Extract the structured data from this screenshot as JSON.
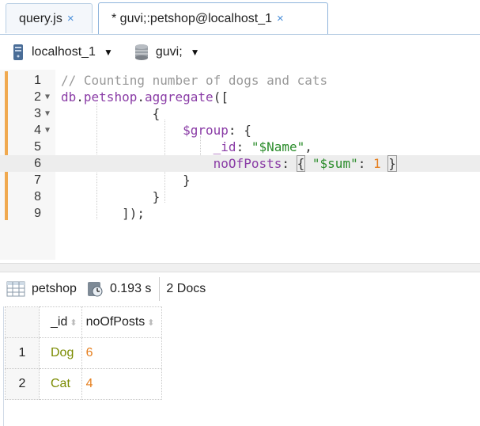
{
  "tabs": [
    {
      "label": "query.js",
      "close": "×"
    },
    {
      "label": "* guvi;:petshop@localhost_1",
      "close": "×"
    }
  ],
  "toolbar": {
    "connection": "localhost_1",
    "database": "guvi;"
  },
  "editor": {
    "lines": [
      {
        "num": "1",
        "fold": ""
      },
      {
        "num": "2",
        "fold": "▼"
      },
      {
        "num": "3",
        "fold": "▼"
      },
      {
        "num": "4",
        "fold": "▼"
      },
      {
        "num": "5",
        "fold": ""
      },
      {
        "num": "6",
        "fold": ""
      },
      {
        "num": "7",
        "fold": ""
      },
      {
        "num": "8",
        "fold": ""
      },
      {
        "num": "9",
        "fold": ""
      }
    ],
    "code": {
      "l1_comment": "// Counting number of dogs and cats",
      "l2_db": "db",
      "l2_petshop": "petshop",
      "l2_aggregate": "aggregate",
      "l2_open": "([",
      "l3": "{",
      "l4_key": "$group",
      "l4_rest": ": {",
      "l5_key": "_id",
      "l5_val": "\"$Name\"",
      "l6_key": "noOfPosts",
      "l6_sum": "\"$sum\"",
      "l6_num": "1",
      "l7": "}",
      "l8": "}",
      "l9": "]);"
    }
  },
  "results": {
    "collection": "petshop",
    "time": "0.193 s",
    "count": "2 Docs",
    "columns": [
      "_id",
      "noOfPosts"
    ],
    "rows": [
      {
        "num": "1",
        "_id": "Dog",
        "noOfPosts": "6"
      },
      {
        "num": "2",
        "_id": "Cat",
        "noOfPosts": "4"
      }
    ]
  }
}
